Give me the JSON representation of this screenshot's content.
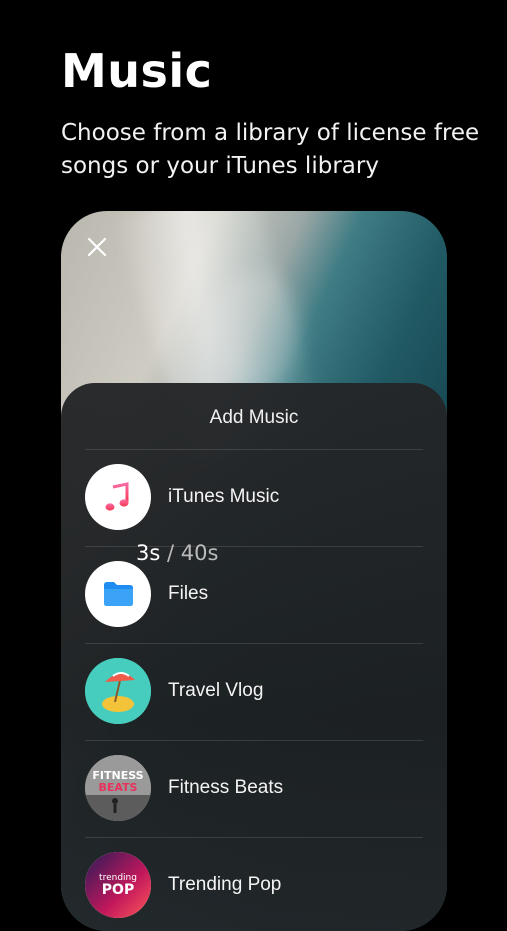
{
  "header": {
    "title": "Music",
    "subtitle": "Choose from a library of license free songs or your iTunes library"
  },
  "sheet": {
    "title": "Add Music",
    "items": [
      {
        "label": "iTunes Music",
        "icon": "music-note-icon"
      },
      {
        "label": "Files",
        "icon": "folder-icon"
      },
      {
        "label": "Travel Vlog",
        "icon": "beach-umbrella-thumbnail"
      },
      {
        "label": "Fitness Beats",
        "icon": "fitness-beats-thumbnail",
        "art_top": "FITNESS",
        "art_bottom": "BEATS"
      },
      {
        "label": "Trending Pop",
        "icon": "trending-pop-thumbnail",
        "art_top": "trending",
        "art_bottom": "POP"
      }
    ]
  },
  "timer": {
    "elapsed": "3s",
    "total": "/ 40s"
  },
  "colors": {
    "background": "#000000",
    "sheet": "#23262a",
    "folder_blue": "#1e8cf0",
    "music_pink": "#f0456e"
  }
}
